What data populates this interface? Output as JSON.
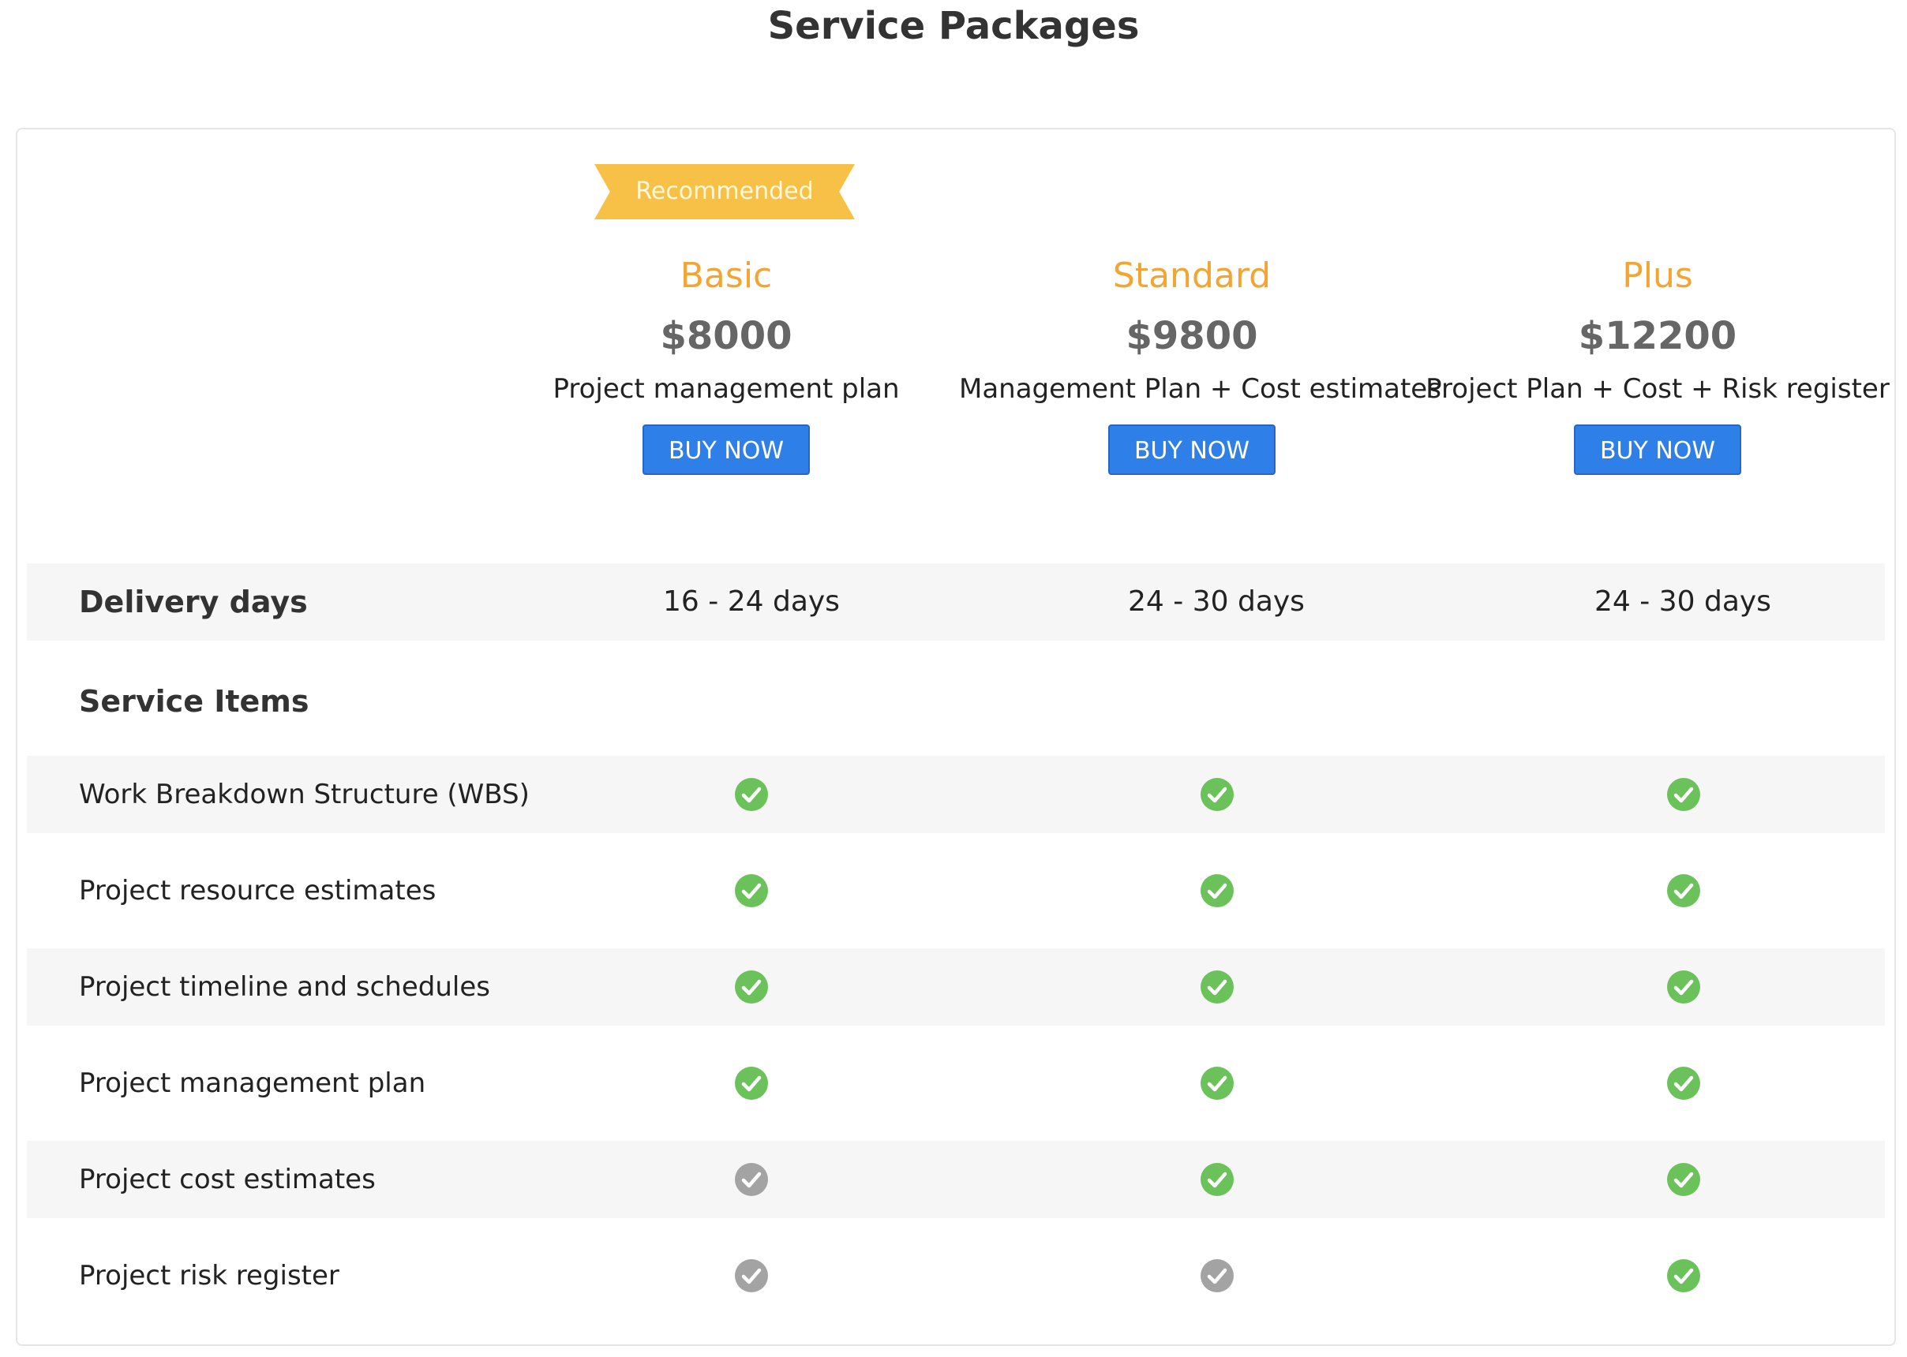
{
  "page": {
    "title": "Service Packages"
  },
  "ribbon": {
    "label": "Recommended"
  },
  "plans": [
    {
      "name": "Basic",
      "price": "$8000",
      "description": "Project management plan",
      "button": "BUY NOW"
    },
    {
      "name": "Standard",
      "price": "$9800",
      "description": "Management Plan + Cost estimates",
      "button": "BUY NOW"
    },
    {
      "name": "Plus",
      "price": "$12200",
      "description": "Project Plan + Cost + Risk register",
      "button": "BUY NOW"
    }
  ],
  "delivery": {
    "label": "Delivery days",
    "values": [
      "16 - 24 days",
      "24 - 30 days",
      "24 - 30 days"
    ]
  },
  "service_items": {
    "heading": "Service Items",
    "items": [
      {
        "label": "Work Breakdown Structure (WBS)",
        "included": [
          true,
          true,
          true
        ]
      },
      {
        "label": "Project resource estimates",
        "included": [
          true,
          true,
          true
        ]
      },
      {
        "label": "Project timeline and schedules",
        "included": [
          true,
          true,
          true
        ]
      },
      {
        "label": "Project management plan",
        "included": [
          true,
          true,
          true
        ]
      },
      {
        "label": "Project cost estimates",
        "included": [
          false,
          true,
          true
        ]
      },
      {
        "label": "Project risk register",
        "included": [
          false,
          false,
          true
        ]
      }
    ]
  },
  "colors": {
    "accent": "#f3a533",
    "button": "#2f7fe9",
    "ribbon": "#f6c146",
    "check_included": "#6cc25a",
    "check_excluded": "#a3a3a3",
    "row_shade": "#f6f6f6"
  }
}
